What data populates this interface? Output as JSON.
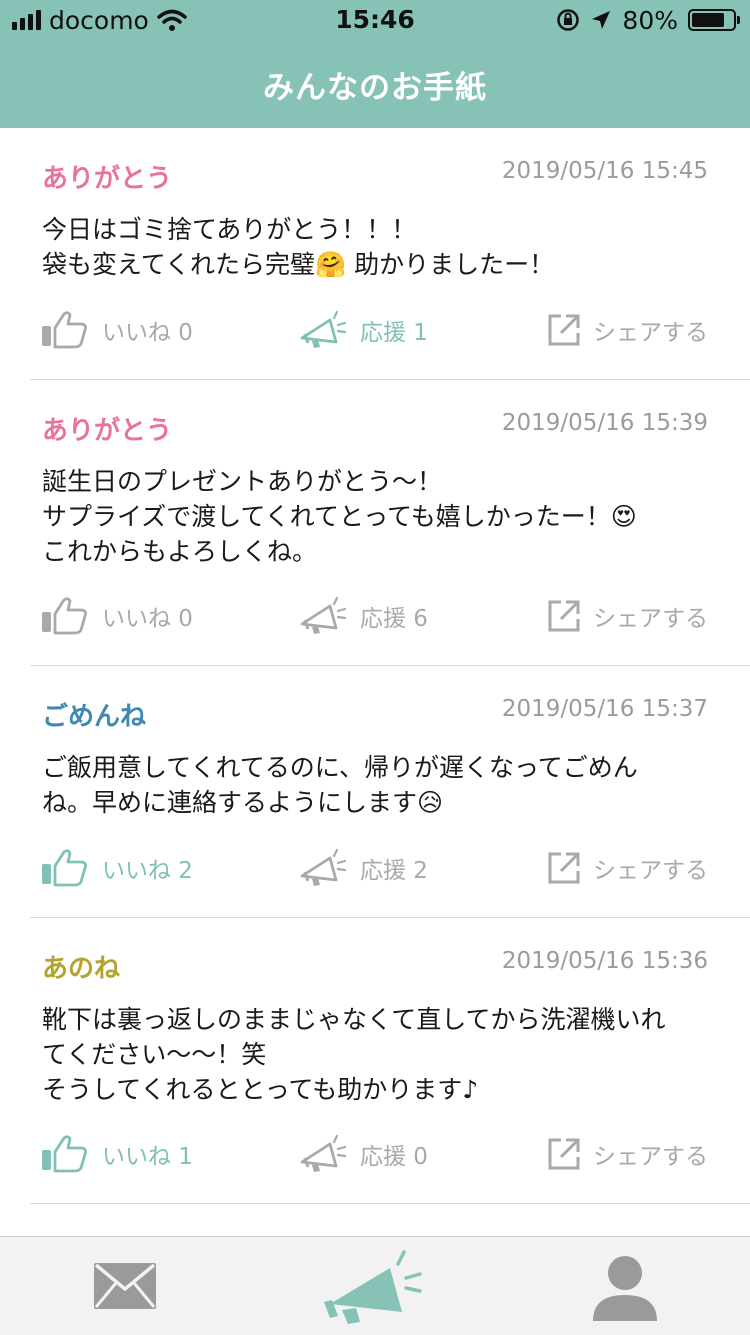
{
  "status_bar": {
    "carrier": "docomo",
    "time": "15:46",
    "battery": "80%",
    "battery_level": 0.8
  },
  "header": {
    "title": "みんなのお手紙"
  },
  "colors": {
    "accent": "#86c3b6",
    "active": "#7fc1b4",
    "inactive": "#a9a9a9",
    "arigatou": "#e8739f",
    "gomenne": "#3f89b3",
    "anone": "#b4a32f"
  },
  "posts": [
    {
      "category": "ありがとう",
      "category_color": "#e8739f",
      "datetime": "2019/05/16 15:45",
      "body": "今日はゴミ捨てありがとう！！！\n袋も変えてくれたら完璧🤗 助かりましたー！",
      "like_label": "いいね 0",
      "like_active": false,
      "cheer_label": "応援 1",
      "cheer_active": true,
      "share_label": "シェアする"
    },
    {
      "category": "ありがとう",
      "category_color": "#e8739f",
      "datetime": "2019/05/16 15:39",
      "body": "誕生日のプレゼントありがとう〜！\nサプライズで渡してくれてとっても嬉しかったー！😍\nこれからもよろしくね。",
      "like_label": "いいね 0",
      "like_active": false,
      "cheer_label": "応援 6",
      "cheer_active": false,
      "share_label": "シェアする"
    },
    {
      "category": "ごめんね",
      "category_color": "#3f89b3",
      "datetime": "2019/05/16 15:37",
      "body": "ご飯用意してくれてるのに、帰りが遅くなってごめん\nね。早めに連絡するようにします😥",
      "like_label": "いいね 2",
      "like_active": true,
      "cheer_label": "応援 2",
      "cheer_active": false,
      "share_label": "シェアする"
    },
    {
      "category": "あのね",
      "category_color": "#b4a32f",
      "datetime": "2019/05/16 15:36",
      "body": "靴下は裏っ返しのままじゃなくて直してから洗濯機いれ\nてください〜〜！笑\nそうしてくれるととっても助かります♪",
      "like_label": "いいね 1",
      "like_active": true,
      "cheer_label": "応援 0",
      "cheer_active": false,
      "share_label": "シェアする"
    }
  ],
  "tab_bar": {
    "items": [
      {
        "icon": "mail-icon",
        "active": false
      },
      {
        "icon": "megaphone-icon",
        "active": true
      },
      {
        "icon": "user-icon",
        "active": false
      }
    ]
  }
}
